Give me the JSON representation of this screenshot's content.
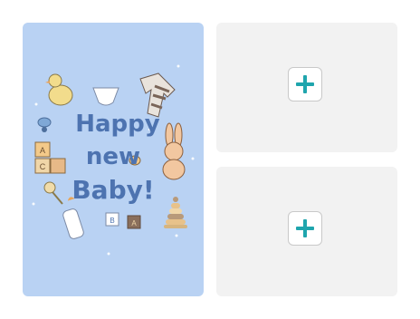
{
  "card": {
    "lines": [
      "Happy",
      "new",
      "Baby!"
    ],
    "cube_letters": [
      "A",
      "C",
      "B",
      "A"
    ]
  },
  "slots": [
    {
      "action": "add",
      "icon": "plus-icon"
    },
    {
      "action": "add",
      "icon": "plus-icon"
    }
  ],
  "colors": {
    "card_bg": "#b9d2f3",
    "slot_bg": "#f2f2f2",
    "accent": "#1fa5ad",
    "lettering": "#4d73b0"
  }
}
